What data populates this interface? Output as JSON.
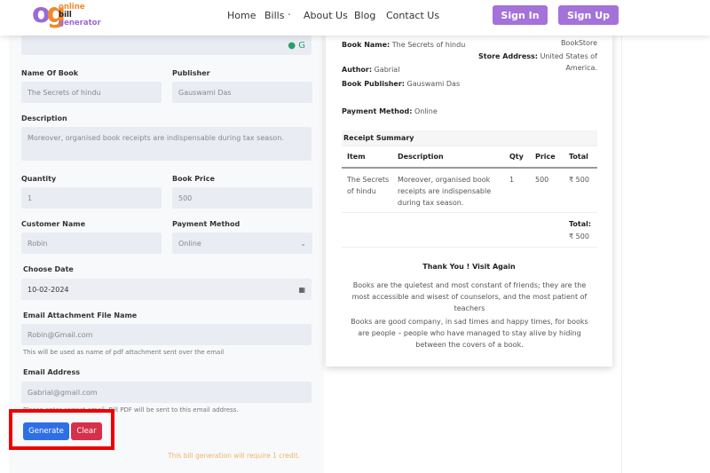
{
  "header": {
    "logo_lines": [
      "online",
      "bill",
      "generator"
    ],
    "nav": [
      "Home",
      "Bills",
      "About Us",
      "Blog",
      "Contact Us"
    ],
    "sign_in": "Sign In",
    "sign_up": "Sign Up"
  },
  "form": {
    "name_label": "Name Of Book",
    "name_value": "The Secrets of hindu",
    "publisher_label": "Publisher",
    "publisher_value": "Gauswami Das",
    "description_label": "Description",
    "description_value": "Moreover, organised book receipts are indispensable during tax season.",
    "quantity_label": "Quantity",
    "quantity_value": "1",
    "price_label": "Book Price",
    "price_value": "500",
    "customer_label": "Customer Name",
    "customer_value": "Robin",
    "payment_label": "Payment Method",
    "payment_value": "Online",
    "date_label": "Choose Date",
    "date_value": "10-02-2024",
    "attach_label": "Email Attachment File Name",
    "attach_value": "Robin@Gmail.com",
    "attach_hint": "This will be used as name of pdf attachment sent over the email",
    "email_label": "Email Address",
    "email_value": "Gabrial@gmail.com",
    "email_hint": "Please enter correct email. Bill PDF will be sent to this email address.",
    "generate": "Generate",
    "clear": "Clear",
    "credit_note": "This bill generation will require 1 credit."
  },
  "receipt": {
    "book_name_label": "Book Name:",
    "book_name": "The Secrets of hindu",
    "author_label": "Author:",
    "author": "Gabrial",
    "publisher_label": "Book Publisher:",
    "publisher": "Gauswami Das",
    "store": "BookStore",
    "store_address_label": "Store Address:",
    "store_address": "United States of America.",
    "payment_label": "Payment Method:",
    "payment": "Online",
    "summary_title": "Receipt Summary",
    "columns": [
      "Item",
      "Description",
      "Qty",
      "Price",
      "Total"
    ],
    "row": [
      "The Secrets of hindu",
      "Moreover, organised book receipts are indispensable during tax season.",
      "1",
      "500",
      "₹ 500"
    ],
    "total_label": "Total:",
    "total": "₹ 500",
    "thanks": "Thank You ! Visit Again",
    "quote1": "Books are the quietest and most constant of friends; they are the most accessible and wisest of counselors, and the most patient of teachers",
    "quote2": "Books are good company, in sad times and happy times, for books are people – people who have managed to stay alive by hiding between the covers of a book."
  },
  "colors": {
    "accent": "#a472d8",
    "generate": "#2f6fe4",
    "clear": "#d6304a",
    "highlight": "#ee0000",
    "credit": "#f0b36a"
  }
}
